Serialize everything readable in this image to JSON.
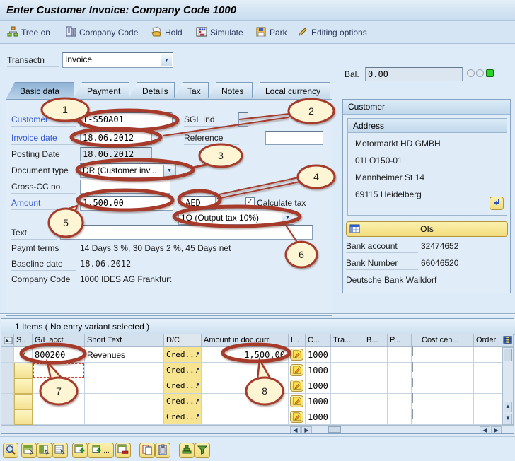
{
  "window": {
    "title": "Enter Customer Invoice: Company Code 1000"
  },
  "app_toolbar": {
    "buttons": [
      {
        "label": "Tree on",
        "icon": "tree-icon"
      },
      {
        "label": "Company Code",
        "icon": "company-code-icon"
      },
      {
        "label": "Hold",
        "icon": "hold-icon"
      },
      {
        "label": "Simulate",
        "icon": "simulate-icon"
      },
      {
        "label": "Park",
        "icon": "park-icon"
      },
      {
        "label": "Editing options",
        "icon": "editing-options-icon"
      }
    ]
  },
  "transaction": {
    "label": "Transactn",
    "value": "Invoice"
  },
  "balance": {
    "label": "Bal.",
    "value": "0.00",
    "status_green": "#2dd12d"
  },
  "tabs": [
    {
      "label": "Basic data",
      "active": true
    },
    {
      "label": "Payment",
      "active": false
    },
    {
      "label": "Details",
      "active": false
    },
    {
      "label": "Tax",
      "active": false
    },
    {
      "label": "Notes",
      "active": false
    },
    {
      "label": "Local currency",
      "active": false
    }
  ],
  "form": {
    "customer": {
      "label": "Customer",
      "value": "T-S50A01"
    },
    "sgl_ind": {
      "label": "SGL Ind",
      "value": ""
    },
    "invoice_date": {
      "label": "Invoice date",
      "value": "18.06.2012"
    },
    "reference": {
      "label": "Reference",
      "value": ""
    },
    "posting_date": {
      "label": "Posting Date",
      "value": "18.06.2012"
    },
    "document_type": {
      "label": "Document type",
      "value": "DR (Customer inv..."
    },
    "cross_cc": {
      "label": "Cross-CC no.",
      "value": ""
    },
    "amount": {
      "label": "Amount",
      "value": "1,500.00",
      "currency": "AED"
    },
    "calculate_tax": {
      "label": "Calculate tax",
      "checked": true
    },
    "tax_code": {
      "value": "1O (Output tax 10%)"
    },
    "text": {
      "label": "Text",
      "value": ""
    },
    "paymt_terms": {
      "label": "Paymt terms",
      "value": "14 Days 3 %, 30 Days 2 %, 45 Days net"
    },
    "baseline_date": {
      "label": "Baseline date",
      "value": "18.06.2012"
    },
    "company_code": {
      "label": "Company Code",
      "value": "1000 IDES AG Frankfurt"
    }
  },
  "customer_panel": {
    "title": "Customer",
    "address": {
      "title": "Address",
      "lines": [
        "Motormarkt HD GMBH",
        "01LO150-01",
        "Mannheimer St 14",
        "69115 Heidelberg"
      ]
    },
    "ois_button": "OIs",
    "bank_account": {
      "label": "Bank account",
      "value": "32474652"
    },
    "bank_number": {
      "label": "Bank Number",
      "value": "66046520"
    },
    "bank_name": "Deutsche Bank Walldorf"
  },
  "items": {
    "header": "1 Items ( No entry variant selected )",
    "columns": [
      "S..",
      "G/L acct",
      "Short Text",
      "D/C",
      "Amount in doc.curr.",
      "L..",
      "C...",
      "Tra...",
      "B...",
      "P...",
      "Cost cen...",
      "Order"
    ],
    "rows": [
      {
        "status": "posted",
        "gl_acct": "800200",
        "short_text": "Revenues",
        "dc": "Cred...",
        "amount": "1,500.00",
        "company": "1000"
      },
      {
        "status": "",
        "gl_acct": "",
        "short_text": "",
        "dc": "Cred...",
        "amount": "",
        "company": "1000",
        "active_cell": true
      },
      {
        "status": "",
        "gl_acct": "",
        "short_text": "",
        "dc": "Cred...",
        "amount": "",
        "company": "1000"
      },
      {
        "status": "",
        "gl_acct": "",
        "short_text": "",
        "dc": "Cred...",
        "amount": "",
        "company": "1000"
      },
      {
        "status": "",
        "gl_acct": "",
        "short_text": "",
        "dc": "Cred...",
        "amount": "",
        "company": "1000"
      }
    ]
  },
  "grid_toolbar": {
    "buttons": [
      {
        "icon": "find-icon"
      },
      {
        "icon": "choose-detail-icon"
      },
      {
        "icon": "change-detail-icon"
      },
      {
        "icon": "display-detail-icon"
      },
      {
        "icon": "insert-row-icon"
      },
      {
        "icon": "insert-row-options-icon",
        "label": "..."
      },
      {
        "icon": "delete-row-icon"
      },
      {
        "icon": "copy-row-icon"
      },
      {
        "icon": "paste-row-icon"
      },
      {
        "icon": "sort-ascending-icon"
      },
      {
        "icon": "filter-icon"
      }
    ]
  },
  "icons": {
    "dropdown-arrow": "▼",
    "checkmark": "✓",
    "scroll-up": "▲",
    "scroll-down": "▼",
    "scroll-left": "◀",
    "scroll-right": "▶"
  },
  "colors": {
    "callout_red": "#a63a2b",
    "balloon_fill": "#fdf5d3",
    "cell_yellow": "#f6e490",
    "status_green": "#2dd12d"
  },
  "callouts": [
    "1",
    "2",
    "3",
    "4",
    "5",
    "6",
    "7",
    "8"
  ]
}
